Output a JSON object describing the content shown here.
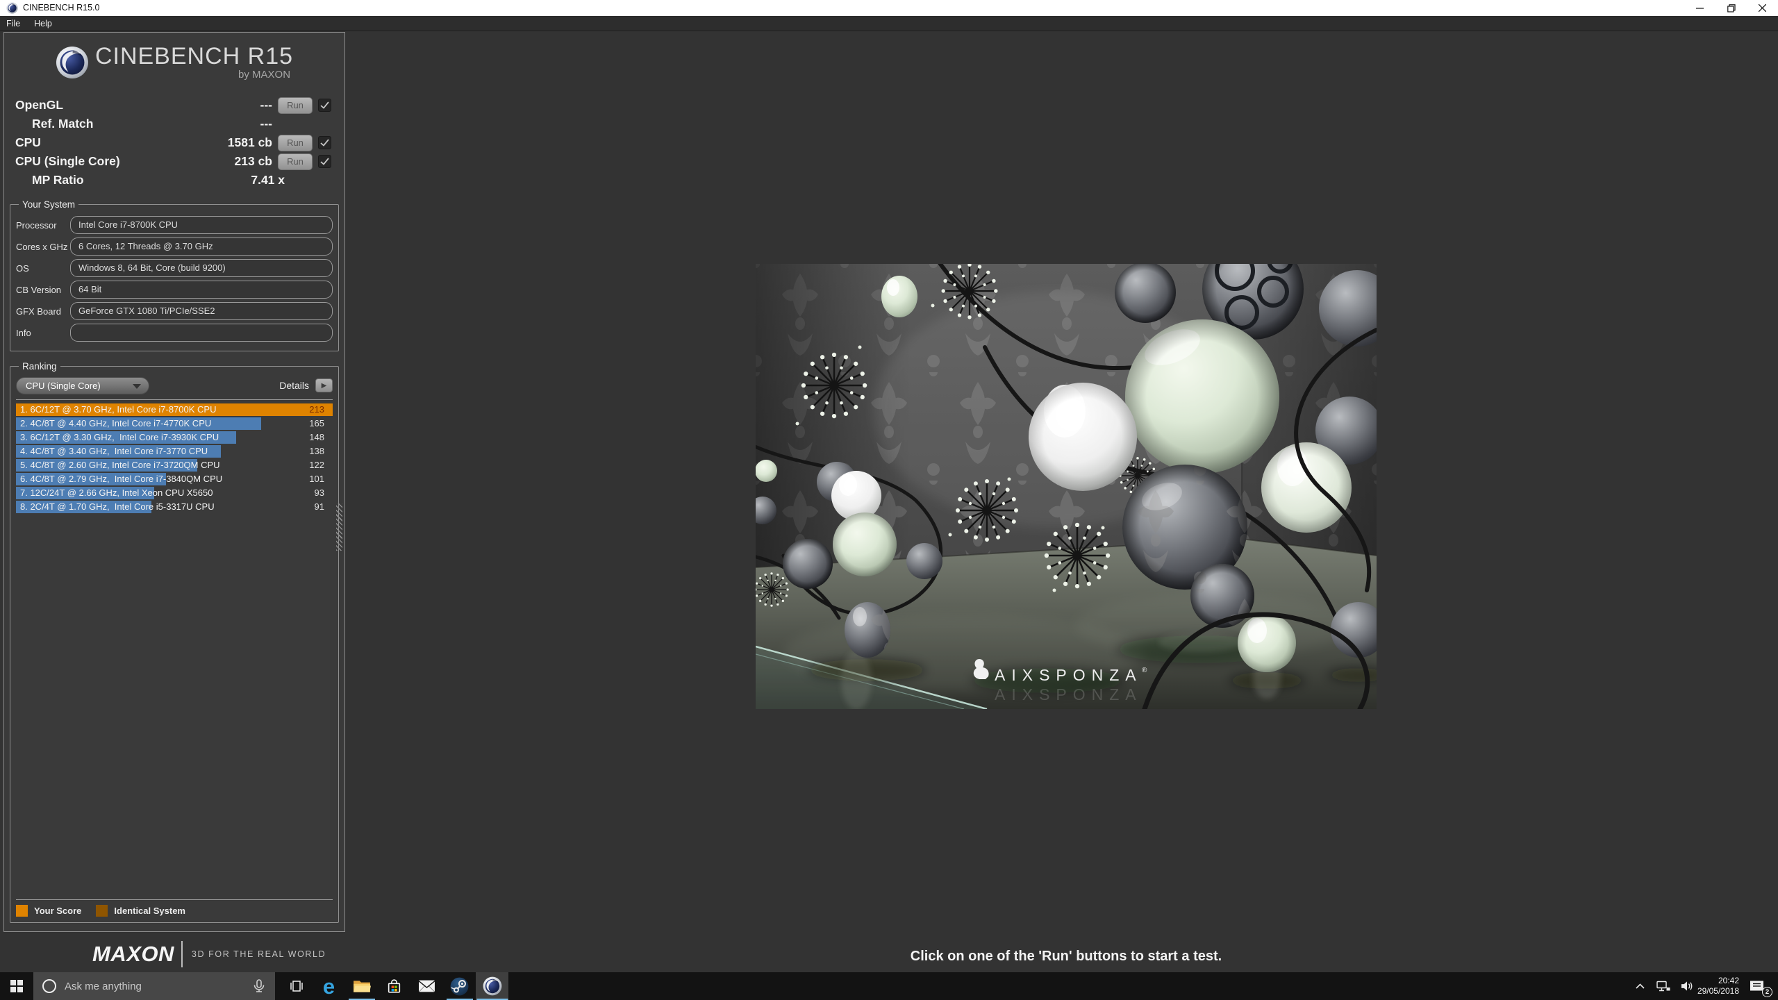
{
  "window": {
    "title": "CINEBENCH R15.0",
    "menus": [
      "File",
      "Help"
    ]
  },
  "brand": {
    "logo_title": "CINEBENCH R15",
    "logo_subtitle": "by MAXON"
  },
  "results": {
    "run_label": "Run",
    "rows": [
      {
        "label": "OpenGL",
        "value": "---",
        "indent": false,
        "has_run": true,
        "has_check": true
      },
      {
        "label": "Ref. Match",
        "value": "---",
        "indent": true,
        "has_run": false,
        "has_check": false
      },
      {
        "label": "CPU",
        "value": "1581 cb",
        "indent": false,
        "has_run": true,
        "has_check": true
      },
      {
        "label": "CPU (Single Core)",
        "value": "213 cb",
        "indent": false,
        "has_run": true,
        "has_check": true
      },
      {
        "label": "MP Ratio",
        "value": "7.41 x",
        "indent": true,
        "has_run": false,
        "has_check": false
      }
    ]
  },
  "your_system": {
    "legend": "Your System",
    "fields": [
      {
        "label": "Processor",
        "value": "Intel Core i7-8700K CPU"
      },
      {
        "label": "Cores x GHz",
        "value": "6 Cores, 12 Threads @ 3.70 GHz"
      },
      {
        "label": "OS",
        "value": "Windows 8, 64 Bit, Core (build 9200)"
      },
      {
        "label": "CB Version",
        "value": "64 Bit"
      },
      {
        "label": "GFX Board",
        "value": "GeForce GTX 1080 Ti/PCIe/SSE2"
      },
      {
        "label": "Info",
        "value": ""
      }
    ]
  },
  "ranking": {
    "legend": "Ranking",
    "filter_value": "CPU (Single Core)",
    "details_label": "Details",
    "chart_data": {
      "type": "bar",
      "orientation": "horizontal",
      "max": 213,
      "categories": [
        "1. 6C/12T @ 3.70 GHz, Intel Core i7-8700K CPU",
        "2. 4C/8T @ 4.40 GHz, Intel Core i7-4770K CPU",
        "3. 6C/12T @ 3.30 GHz,  Intel Core i7-3930K CPU",
        "4. 4C/8T @ 3.40 GHz,  Intel Core i7-3770 CPU",
        "5. 4C/8T @ 2.60 GHz, Intel Core i7-3720QM CPU",
        "6. 4C/8T @ 2.79 GHz,  Intel Core i7-3840QM CPU",
        "7. 12C/24T @ 2.66 GHz, Intel Xeon CPU X5650",
        "8. 2C/4T @ 1.70 GHz,  Intel Core i5-3317U CPU"
      ],
      "values": [
        213,
        165,
        148,
        138,
        122,
        101,
        93,
        91
      ],
      "highlight_index": 0,
      "bar_color": "#4d7db3",
      "highlight_color": "#df8300",
      "legend_position": "bottom"
    },
    "entries": [
      {
        "label": "1. 6C/12T @ 3.70 GHz, Intel Core i7-8700K CPU",
        "value": 213,
        "type": "your_score"
      },
      {
        "label": "2. 4C/8T @ 4.40 GHz, Intel Core i7-4770K CPU",
        "value": 165,
        "type": "other"
      },
      {
        "label": "3. 6C/12T @ 3.30 GHz,  Intel Core i7-3930K CPU",
        "value": 148,
        "type": "other"
      },
      {
        "label": "4. 4C/8T @ 3.40 GHz,  Intel Core i7-3770 CPU",
        "value": 138,
        "type": "other"
      },
      {
        "label": "5. 4C/8T @ 2.60 GHz, Intel Core i7-3720QM CPU",
        "value": 122,
        "type": "other"
      },
      {
        "label": "6. 4C/8T @ 2.79 GHz,  Intel Core i7-3840QM CPU",
        "value": 101,
        "type": "other"
      },
      {
        "label": "7. 12C/24T @ 2.66 GHz, Intel Xeon CPU X5650",
        "value": 93,
        "type": "other"
      },
      {
        "label": "8. 2C/4T @ 1.70 GHz,  Intel Core i5-3317U CPU",
        "value": 91,
        "type": "other"
      }
    ],
    "legend_items": [
      {
        "label": "Your Score",
        "color": "#df8300"
      },
      {
        "label": "Identical System",
        "color": "#8f5500"
      }
    ]
  },
  "footer": {
    "brand": "MAXON",
    "tagline": "3D FOR THE REAL WORLD"
  },
  "main": {
    "hint": "Click on one of the 'Run' buttons to start a test.",
    "scene_credit": "AIXSPONZA"
  },
  "taskbar": {
    "search_placeholder": "Ask me anything",
    "apps": [
      "task-view",
      "edge",
      "file-explorer",
      "store",
      "mail",
      "steam",
      "cinebench"
    ],
    "tray": {
      "time": "20:42",
      "date": "29/05/2018",
      "notification_count": "2"
    }
  }
}
